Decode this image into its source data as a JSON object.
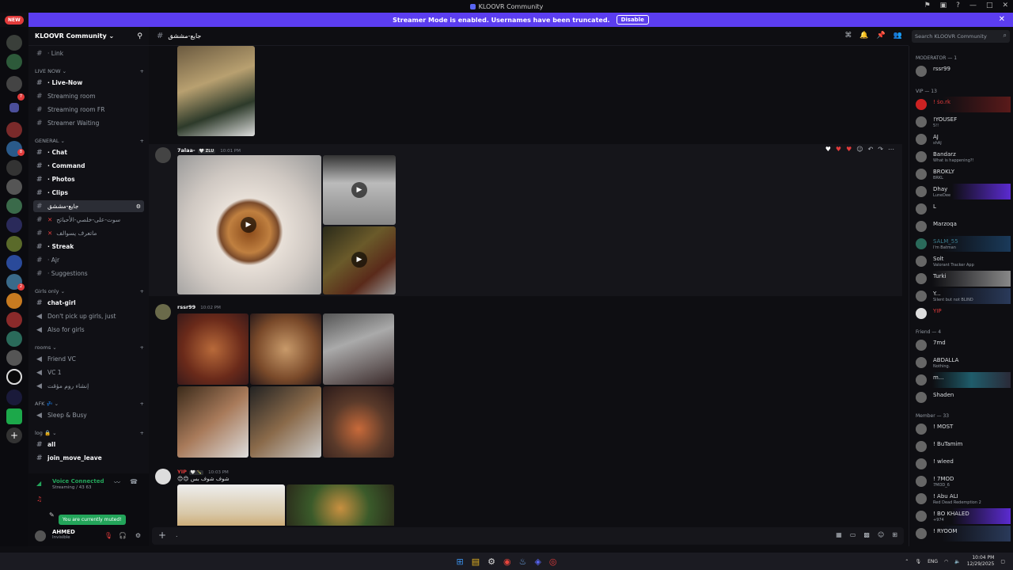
{
  "window": {
    "title": "KLOOVR Community",
    "new_badge": "NEW"
  },
  "banner": {
    "text": "Streamer Mode is enabled. Usernames have been truncated.",
    "disable": "Disable"
  },
  "server": {
    "name": "KLOOVR Community ⌄"
  },
  "channels": {
    "link": "· Link",
    "cat_live": "LIVE NOW ⌄",
    "live_now": "· Live-Now",
    "streaming_room": "Streaming room",
    "streaming_room_fr": "Streaming room FR",
    "streamer_waiting": "Streamer Waiting",
    "cat_general": "GENERAL ⌄",
    "chat": "· Chat",
    "command": "· Command",
    "photos": "· Photos",
    "clips": "· Clips",
    "selected": "جايع-مششق",
    "voice_sad": "سوت-على-خلصي-الأحبائح",
    "whisper": "ماتعرف يسوالف",
    "streak": "· Streak",
    "ajr": "· Ajr",
    "suggestions": "· Suggestions",
    "cat_girls": "Girls only ⌄",
    "chat_girl": "chat-girl",
    "dont_pick": "Don't pick up girls, just",
    "also_girls": "Also for girls",
    "cat_rooms": "rooms ⌄",
    "friend_vc": "Friend VC",
    "vc1": "VC 1",
    "insha": "إنشاء روم مؤقت",
    "cat_afk": "AFK 💤 ⌄",
    "sleep": "Sleep & Busy",
    "cat_log": "log 🔒 ⌄",
    "all": "all",
    "join_move": "join_move_leave"
  },
  "voice": {
    "status": "Voice Connected",
    "sub": "Streaming / 43 63",
    "muted": "You are currently muted!",
    "user": "AHMED",
    "user_status": "Invisible"
  },
  "topbar": {
    "channel": "جايع-مششق"
  },
  "search": {
    "placeholder": "Search KLOOVR Community"
  },
  "messages": [
    {
      "author": "7alaa-",
      "tag": "🤍 ZLU",
      "time": "10:01 PM"
    },
    {
      "author": "rssr99",
      "time": "10:02 PM"
    },
    {
      "author": "YIP",
      "tag": "🤍 🍾",
      "time": "10:03 PM",
      "text": "😊😊 شوف شوف بس"
    }
  ],
  "composer": {
    "placeholder": "."
  },
  "members": {
    "moderator_header": "MODERATOR — 1",
    "vip_header": "VIP — 13",
    "friend_header": "Friend — 4",
    "member_header": "Member — 33",
    "moderator": [
      {
        "name": "rssr99"
      }
    ],
    "vip": [
      {
        "name": "! ṡo.rk",
        "status": ""
      },
      {
        "name": "!YOUSEF",
        "status": "5!!"
      },
      {
        "name": "AJ",
        "status": "shAJ"
      },
      {
        "name": "Bandarz",
        "status": "What is happening?!"
      },
      {
        "name": "BROKLY",
        "status": "BRKL"
      },
      {
        "name": "Dhay",
        "status": "LuneDee"
      },
      {
        "name": "L",
        "status": ""
      },
      {
        "name": "Marzoqa",
        "status": ""
      },
      {
        "name": "SALM_55",
        "status": "I'm Batman"
      },
      {
        "name": "Solt",
        "status": "Valorant Tracker App"
      },
      {
        "name": "Turki",
        "status": ""
      },
      {
        "name": "Y...",
        "status": "Silent but not BLIND"
      },
      {
        "name": "YIP",
        "status": ""
      }
    ],
    "friend": [
      {
        "name": "7md",
        "status": ""
      },
      {
        "name": "ABDALLA",
        "status": "Nothing."
      },
      {
        "name": "m...",
        "status": ""
      },
      {
        "name": "Shaden",
        "status": ""
      }
    ],
    "member": [
      {
        "name": "! MOST",
        "status": ""
      },
      {
        "name": "! BuTamim",
        "status": ""
      },
      {
        "name": "! wleed",
        "status": ""
      },
      {
        "name": "! 7MOD",
        "status": "7MOD_6"
      },
      {
        "name": "! Abu ALI",
        "status": "Red Dead Redemption 2"
      },
      {
        "name": "! BO KHALED",
        "status": "+974"
      },
      {
        "name": "! RYOOM",
        "status": ""
      }
    ]
  },
  "tray": {
    "lang": "ENG",
    "time": "10:04 PM",
    "date": "12/29/2025"
  }
}
